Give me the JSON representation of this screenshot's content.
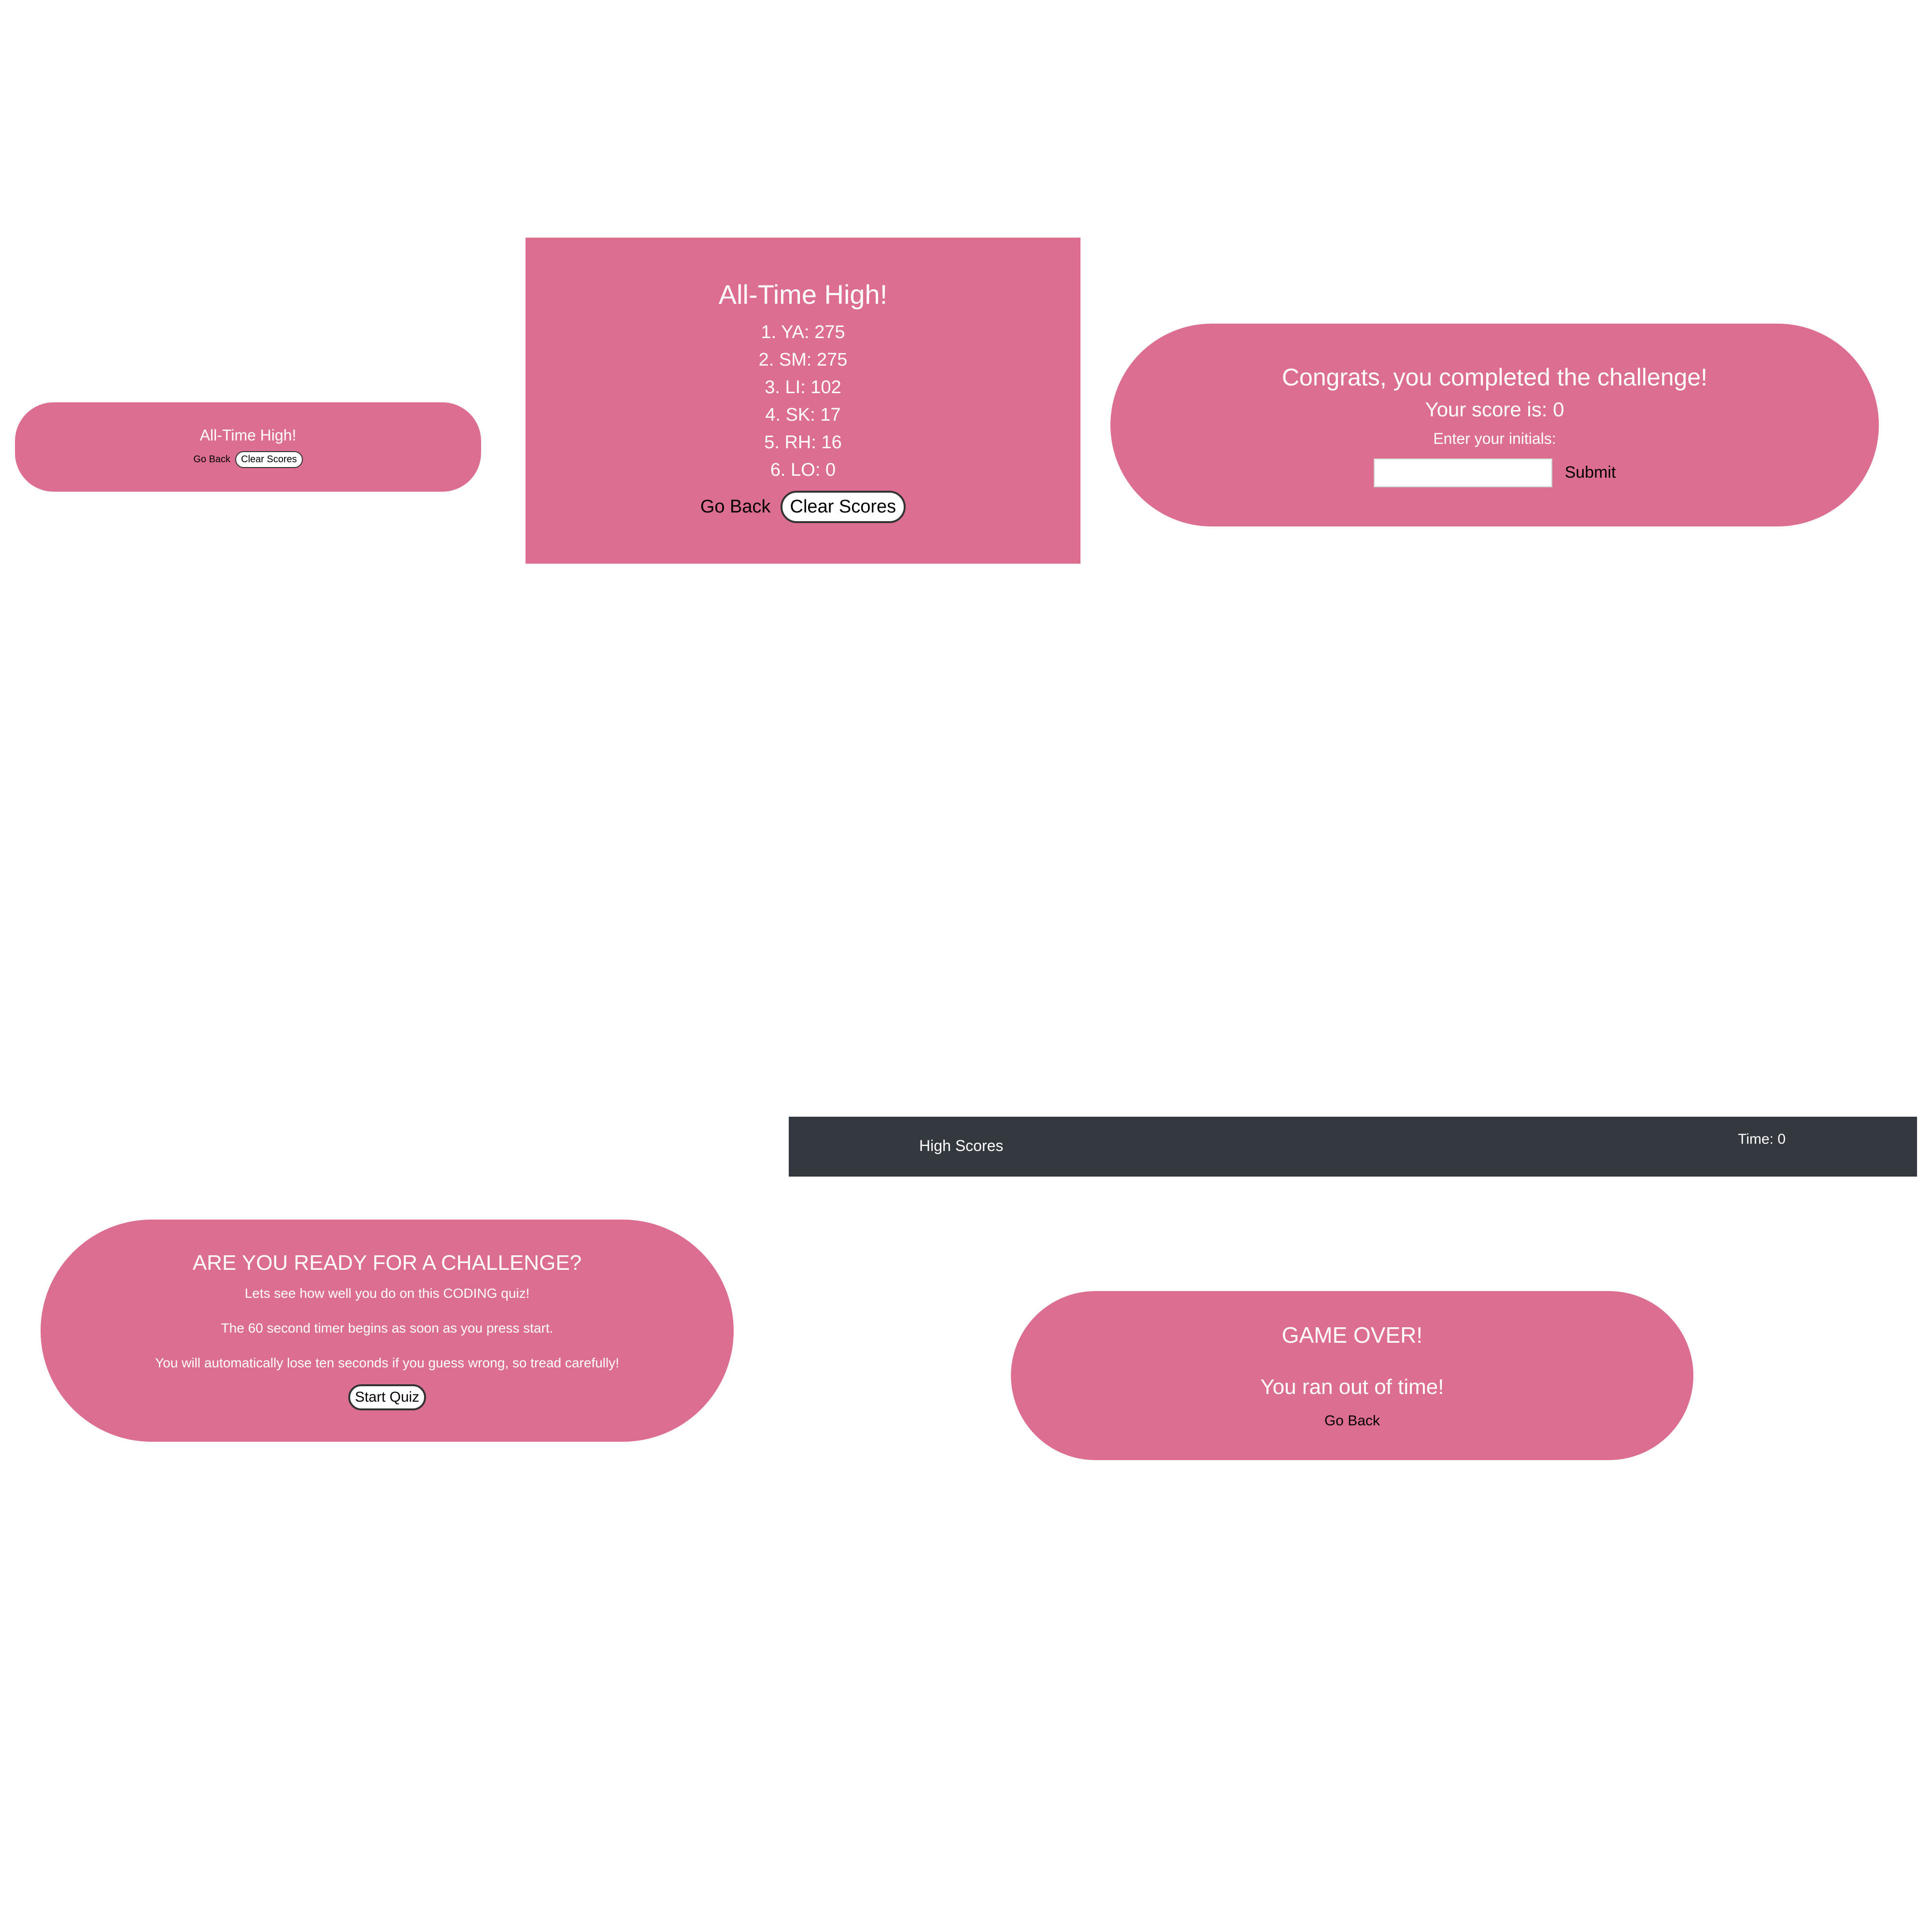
{
  "high_scores_small": {
    "title": "All-Time High!",
    "go_back": "Go Back",
    "clear": "Clear Scores"
  },
  "high_scores_large": {
    "title": "All-Time High!",
    "scores": [
      "1. YA: 275",
      "2. SM: 275",
      "3.  LI: 102",
      "4.  SK: 17",
      "5.  RH: 16",
      "6.   LO: 0"
    ],
    "go_back": "Go Back",
    "clear": "Clear Scores"
  },
  "congrats": {
    "title": "Congrats, you completed the challenge!",
    "score": "Your score is: 0",
    "label": "Enter your initials:",
    "input_value": "",
    "submit": "Submit"
  },
  "start": {
    "title": "ARE YOU READY FOR A CHALLENGE?",
    "line1": "Lets see how well you do on this CODING quiz!",
    "line2": "The 60 second timer begins as soon as you press start.",
    "line3": "You will automatically lose ten seconds if you guess wrong, so tread carefully!",
    "button": "Start Quiz"
  },
  "navbar": {
    "high_scores": "High Scores",
    "time": "Time: 0"
  },
  "game_over": {
    "title": "GAME OVER!",
    "message": "You ran out of time!",
    "go_back": "Go Back"
  },
  "colors": {
    "card": "#dc6e8f",
    "navbar": "#33383f",
    "text": "#ffffff"
  }
}
